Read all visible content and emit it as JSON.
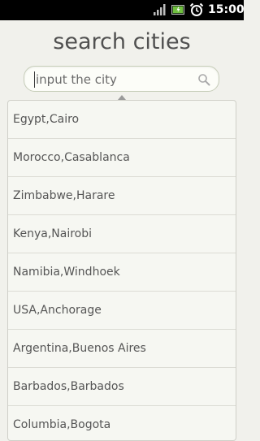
{
  "status_bar": {
    "time": "15:00",
    "icons": [
      "signal-icon",
      "battery-icon",
      "alarm-clock-icon"
    ]
  },
  "title": "search cities",
  "search": {
    "value": "",
    "placeholder": "input the city",
    "icon": "search-icon"
  },
  "colors": {
    "background": "#f1f1ec",
    "status_bar": "#000000",
    "title_text": "#505050",
    "list_text": "#555555",
    "battery_green": "#6fbf3e"
  },
  "cities": [
    {
      "label": "Egypt,Cairo"
    },
    {
      "label": "Morocco,Casablanca"
    },
    {
      "label": "Zimbabwe,Harare"
    },
    {
      "label": "Kenya,Nairobi"
    },
    {
      "label": "Namibia,Windhoek"
    },
    {
      "label": "USA,Anchorage"
    },
    {
      "label": "Argentina,Buenos Aires"
    },
    {
      "label": "Barbados,Barbados"
    },
    {
      "label": "Columbia,Bogota"
    }
  ]
}
